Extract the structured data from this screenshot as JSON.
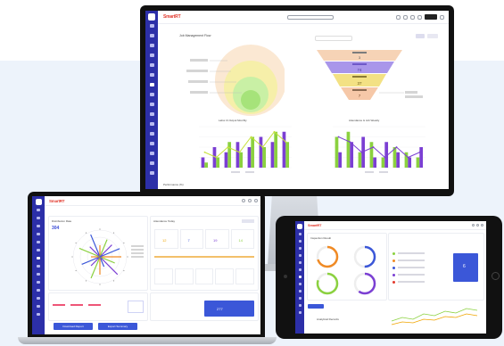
{
  "brand": {
    "name": "SmartRT",
    "color": "#e23a2e",
    "sidebar_color": "#2c2fa8"
  },
  "monitor": {
    "panel_title": "Job Management Flow",
    "funnel_values": [
      "3",
      "74",
      "37",
      "7"
    ],
    "chart_left_title": "Labor & Output Monthly",
    "chart_right_title": "Attendance & Job Weekly",
    "footer_note": "Performance (%)"
  },
  "laptop": {
    "panel_left_title": "Distribution Rate",
    "big_value": "304",
    "panel_right_title": "Attendance Today",
    "stat_cards": [
      "12",
      "7",
      "19",
      "14"
    ],
    "bottom_value": "277",
    "button_left": "Download Report",
    "button_right": "Export Summary"
  },
  "tablet": {
    "panel_left_title": "Inspection Result",
    "card_value": "6",
    "bottom_text": "Analytical Records"
  },
  "chart_data": [
    {
      "type": "bar",
      "title": "Labor & Output Monthly",
      "categories": [
        "1",
        "2",
        "3",
        "4",
        "5",
        "6",
        "7",
        "8"
      ],
      "series": [
        {
          "name": "",
          "values": [
            2,
            4,
            3,
            5,
            4,
            6,
            5,
            7
          ],
          "color": "#7b3fd3"
        },
        {
          "name": "",
          "values": [
            1,
            2,
            5,
            3,
            6,
            4,
            7,
            5
          ],
          "color": "#8bd13f"
        }
      ],
      "line": [
        3,
        2,
        4,
        3,
        6,
        4,
        7,
        5
      ],
      "line_color": "#c6e23a",
      "ylim": [
        0,
        8
      ]
    },
    {
      "type": "bar",
      "title": "Attendance & Job Weekly",
      "categories": [
        "1",
        "2",
        "3",
        "4",
        "5",
        "6",
        "7",
        "8"
      ],
      "series": [
        {
          "name": "",
          "values": [
            6,
            7,
            3,
            5,
            2,
            4,
            3,
            2
          ],
          "color": "#8bd13f"
        },
        {
          "name": "",
          "values": [
            3,
            5,
            6,
            2,
            5,
            3,
            2,
            4
          ],
          "color": "#7b3fd3"
        }
      ],
      "line": [
        6,
        5,
        3,
        4,
        2,
        4,
        2,
        3
      ],
      "line_color": "#7b3fd3",
      "ylim": [
        0,
        8
      ]
    }
  ]
}
